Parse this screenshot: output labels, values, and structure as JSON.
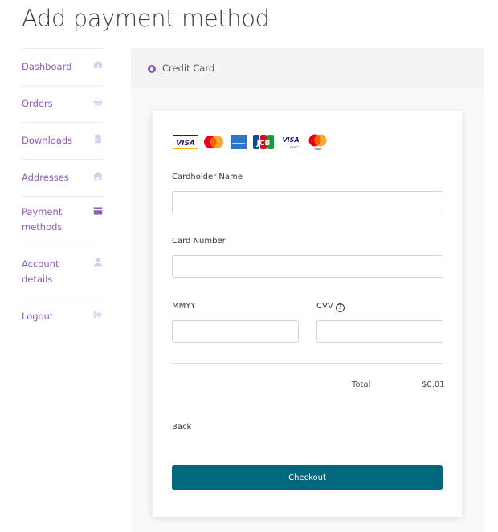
{
  "page": {
    "title": "Add payment method"
  },
  "sidebar": {
    "items": [
      {
        "label": "Dashboard",
        "icon": "dashboard-gauge-icon",
        "active": false
      },
      {
        "label": "Orders",
        "icon": "basket-icon",
        "active": false
      },
      {
        "label": "Downloads",
        "icon": "file-download-icon",
        "active": false
      },
      {
        "label": "Addresses",
        "icon": "home-icon",
        "active": false
      },
      {
        "label": "Payment methods",
        "icon": "credit-card-icon",
        "active": true
      },
      {
        "label": "Account details",
        "icon": "user-icon",
        "active": false
      },
      {
        "label": "Logout",
        "icon": "sign-out-icon",
        "active": false
      }
    ]
  },
  "payment": {
    "method_label": "Credit Card",
    "method_selected": true,
    "card_logos": [
      "Visa",
      "Mastercard",
      "American Express",
      "JCB",
      "Visa Debit",
      "Mastercard Debit"
    ],
    "logo_text": {
      "visa": "VISA",
      "jcb": "JCB",
      "visa_debit": "VISA",
      "debit": "DEBIT",
      "mc_debit": "debit"
    },
    "fields": {
      "cardholder_name": {
        "label": "Cardholder Name",
        "value": "",
        "placeholder": ""
      },
      "card_number": {
        "label": "Card Number",
        "value": "",
        "placeholder": ""
      },
      "expiry": {
        "label": "MMYY",
        "value": "",
        "placeholder": ""
      },
      "cvv": {
        "label": "CVV",
        "value": "",
        "placeholder": "",
        "help_glyph": "?"
      }
    },
    "total_label": "Total",
    "total_value": "$0.01",
    "back_label": "Back",
    "checkout_label": "Checkout"
  },
  "colors": {
    "accent": "#8b5cb8",
    "checkout_button": "#00677d",
    "method_bar_bg": "#f3f3f3"
  }
}
